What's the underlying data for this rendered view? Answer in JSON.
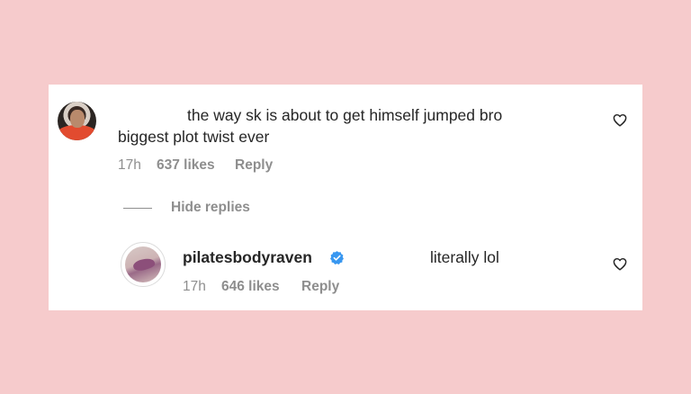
{
  "comment": {
    "line1": "the way sk is about to get himself jumped bro",
    "line2": "biggest plot twist ever",
    "time": "17h",
    "likes": "637 likes",
    "reply_label": "Reply"
  },
  "hide_replies_label": "Hide replies",
  "reply_comment": {
    "username": "pilatesbodyraven",
    "text": "literally lol",
    "time": "17h",
    "likes": "646 likes",
    "reply_label": "Reply"
  },
  "colors": {
    "background": "#f6cbcc",
    "card": "#ffffff",
    "text": "#262626",
    "muted": "#8e8e8e",
    "verified": "#3897f0"
  },
  "icons": {
    "like": "heart-icon",
    "verified": "verified-badge-icon"
  }
}
